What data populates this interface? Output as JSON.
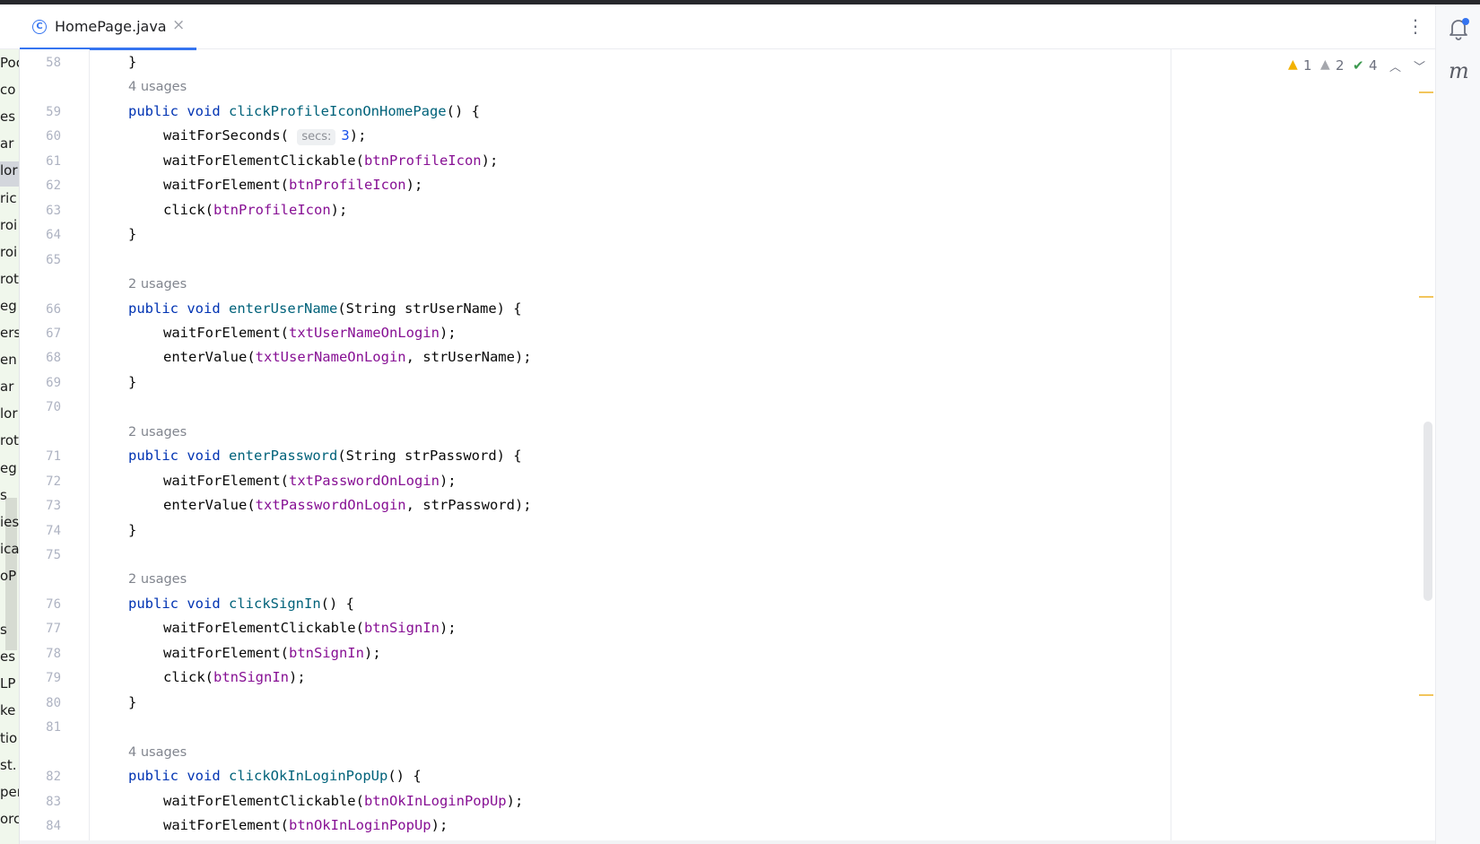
{
  "tab": {
    "icon": "class-c-icon",
    "file_name": "HomePage.java",
    "close_glyph": "×"
  },
  "toolbar": {
    "more_glyph": "⋮"
  },
  "inspections": {
    "warnings": "1",
    "weak_warnings": "2",
    "ok": "4"
  },
  "right_stripe": {
    "notifications_icon": "bell-icon",
    "m_label": "m"
  },
  "project_tree_fragments": [
    "Poc",
    "co",
    "es",
    "ar",
    "lor",
    "ric",
    "roi",
    "roi",
    "rot",
    "eg",
    "ers",
    "en",
    "ar",
    "lor",
    "rot",
    "eg",
    "s",
    "ies",
    "ica",
    "oP",
    "",
    "s",
    "es",
    "LP",
    "ke",
    "tio",
    "st.",
    "per",
    "orc"
  ],
  "code": {
    "lines": [
      {
        "n": "58",
        "text": "}"
      },
      {
        "usage": "4 usages"
      },
      {
        "n": "59",
        "text": "public void clickProfileIconOnHomePage() {"
      },
      {
        "n": "60",
        "text": "waitForSeconds( secs: 3);",
        "hint": "secs:",
        "value": "3"
      },
      {
        "n": "61",
        "text": "waitForElementClickable(btnProfileIcon);"
      },
      {
        "n": "62",
        "text": "waitForElement(btnProfileIcon);"
      },
      {
        "n": "63",
        "text": "click(btnProfileIcon);"
      },
      {
        "n": "64",
        "text": "}"
      },
      {
        "n": "65",
        "text": ""
      },
      {
        "usage": "2 usages"
      },
      {
        "n": "66",
        "text": "public void enterUserName(String strUserName) {"
      },
      {
        "n": "67",
        "text": "waitForElement(txtUserNameOnLogin);"
      },
      {
        "n": "68",
        "text": "enterValue(txtUserNameOnLogin, strUserName);"
      },
      {
        "n": "69",
        "text": "}"
      },
      {
        "n": "70",
        "text": ""
      },
      {
        "usage": "2 usages"
      },
      {
        "n": "71",
        "text": "public void enterPassword(String strPassword) {"
      },
      {
        "n": "72",
        "text": "waitForElement(txtPasswordOnLogin);"
      },
      {
        "n": "73",
        "text": "enterValue(txtPasswordOnLogin, strPassword);"
      },
      {
        "n": "74",
        "text": "}"
      },
      {
        "n": "75",
        "text": ""
      },
      {
        "usage": "2 usages"
      },
      {
        "n": "76",
        "text": "public void clickSignIn() {"
      },
      {
        "n": "77",
        "text": "waitForElementClickable(btnSignIn);"
      },
      {
        "n": "78",
        "text": "waitForElement(btnSignIn);"
      },
      {
        "n": "79",
        "text": "click(btnSignIn);"
      },
      {
        "n": "80",
        "text": "}"
      },
      {
        "n": "81",
        "text": ""
      },
      {
        "usage": "4 usages"
      },
      {
        "n": "82",
        "text": "public void clickOkInLoginPopUp() {"
      },
      {
        "n": "83",
        "text": "waitForElementClickable(btnOkInLoginPopUp);"
      },
      {
        "n": "84",
        "text": "waitForElement(btnOkInLoginPopUp);"
      }
    ],
    "tokens": {
      "kw_public": "public",
      "kw_void": "void",
      "kw_string": "String"
    }
  }
}
